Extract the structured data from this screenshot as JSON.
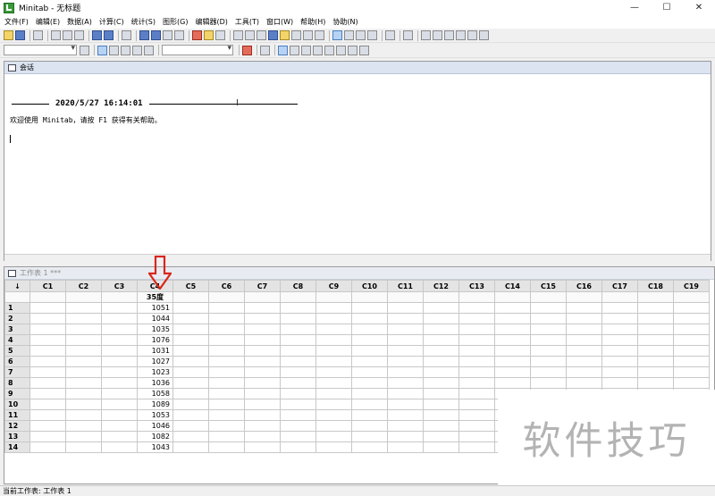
{
  "window": {
    "title": "Minitab - 无标题",
    "minimize": "—",
    "maximize": "☐",
    "close": "✕"
  },
  "menu": [
    "文件(F)",
    "编辑(E)",
    "数据(A)",
    "计算(C)",
    "统计(S)",
    "图形(G)",
    "编辑器(D)",
    "工具(T)",
    "窗口(W)",
    "帮助(H)",
    "协助(N)"
  ],
  "session": {
    "title": "会话",
    "timestamp": "2020/5/27 16:14:01",
    "welcome": "欢迎使用 Minitab，请按 F1 获得有关帮助。"
  },
  "worksheet": {
    "title": "工作表 1 ***",
    "corner": "↓",
    "columns": [
      "C1",
      "C2",
      "C3",
      "C4",
      "C5",
      "C6",
      "C7",
      "C8",
      "C9",
      "C10",
      "C11",
      "C12",
      "C13",
      "C14",
      "C15",
      "C16",
      "C17",
      "C18",
      "C19"
    ],
    "column_names": [
      "",
      "",
      "",
      "35度",
      "",
      "",
      "",
      "",
      "",
      "",
      "",
      "",
      "",
      "",
      "",
      "",
      "",
      "",
      ""
    ],
    "rows": [
      {
        "n": "1",
        "c4": "1051"
      },
      {
        "n": "2",
        "c4": "1044"
      },
      {
        "n": "3",
        "c4": "1035"
      },
      {
        "n": "4",
        "c4": "1076"
      },
      {
        "n": "5",
        "c4": "1031"
      },
      {
        "n": "6",
        "c4": "1027"
      },
      {
        "n": "7",
        "c4": "1023"
      },
      {
        "n": "8",
        "c4": "1036"
      },
      {
        "n": "9",
        "c4": "1058"
      },
      {
        "n": "10",
        "c4": "1089"
      },
      {
        "n": "11",
        "c4": "1053"
      },
      {
        "n": "12",
        "c4": "1046"
      },
      {
        "n": "13",
        "c4": "1082"
      },
      {
        "n": "14",
        "c4": "1043"
      }
    ]
  },
  "status": {
    "text": "当前工作表: 工作表 1"
  },
  "watermark": {
    "text": "软件技巧"
  },
  "annotation": {
    "arrow_color": "#d9261c"
  }
}
